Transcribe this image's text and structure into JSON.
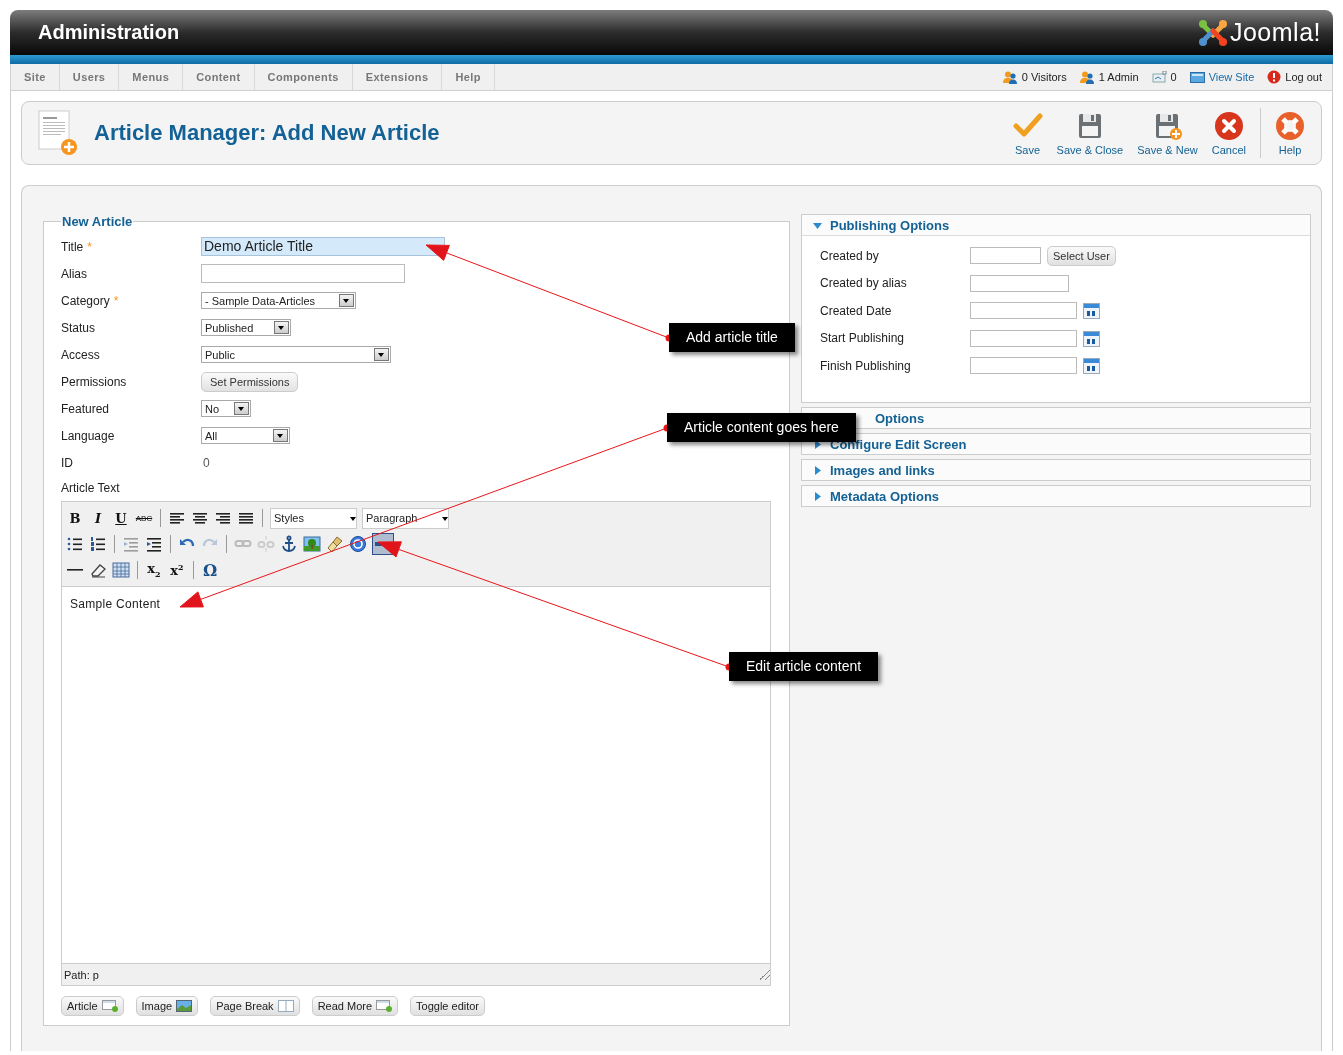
{
  "header": {
    "title": "Administration",
    "logo": "Joomla!"
  },
  "menu": [
    {
      "label": "Site"
    },
    {
      "label": "Users"
    },
    {
      "label": "Menus"
    },
    {
      "label": "Content"
    },
    {
      "label": "Components"
    },
    {
      "label": "Extensions"
    },
    {
      "label": "Help"
    }
  ],
  "status": [
    {
      "kind": "visitors",
      "label": "0 Visitors"
    },
    {
      "kind": "admins",
      "label": "1 Admin"
    },
    {
      "kind": "messages",
      "label": "0"
    },
    {
      "kind": "view-site",
      "label": "View Site"
    },
    {
      "kind": "logout",
      "label": "Log out"
    }
  ],
  "page_title": "Article Manager: Add New Article",
  "toolbar": [
    {
      "kind": "save",
      "label": "Save"
    },
    {
      "kind": "save-close",
      "label": "Save & Close"
    },
    {
      "kind": "save-new",
      "label": "Save & New"
    },
    {
      "kind": "cancel",
      "label": "Cancel"
    },
    {
      "kind": "help",
      "label": "Help"
    }
  ],
  "form": {
    "legend": "New Article",
    "required_mark": "*",
    "fields": [
      {
        "label": "Title",
        "required": true,
        "kind": "text",
        "value": "Demo Article Title",
        "focused": true
      },
      {
        "label": "Alias",
        "required": false,
        "kind": "text",
        "focused": false
      },
      {
        "label": "Category",
        "required": true,
        "kind": "select",
        "value": "- Sample Data-Articles"
      },
      {
        "label": "Status",
        "required": false,
        "kind": "select",
        "value": "Published"
      },
      {
        "label": "Access",
        "required": false,
        "kind": "select",
        "value": "Public"
      },
      {
        "label": "Permissions",
        "required": false,
        "kind": "button",
        "value": "Set Permissions"
      },
      {
        "label": "Featured",
        "required": false,
        "kind": "select",
        "value": "No"
      },
      {
        "label": "Language",
        "required": false,
        "kind": "select",
        "value": "All"
      },
      {
        "label": "ID",
        "required": false,
        "kind": "static",
        "value": "0"
      }
    ]
  },
  "editor": {
    "label": "Article Text",
    "content": "Sample Content",
    "path": "Path: p",
    "tools": [
      [
        {
          "kind": "bold",
          "text": "B"
        },
        {
          "kind": "italic",
          "text": "I"
        },
        {
          "kind": "underline",
          "text": "U"
        },
        {
          "kind": "strike",
          "text": "ABC"
        },
        {
          "kind": "separator"
        },
        {
          "kind": "align-left"
        },
        {
          "kind": "align-center"
        },
        {
          "kind": "align-right"
        },
        {
          "kind": "justify"
        },
        {
          "kind": "separator"
        },
        {
          "kind": "select",
          "text": "Styles"
        },
        {
          "kind": "select",
          "text": "Paragraph"
        }
      ],
      [
        {
          "kind": "bullet-list"
        },
        {
          "kind": "numbered-list"
        },
        {
          "kind": "separator"
        },
        {
          "kind": "outdent"
        },
        {
          "kind": "indent"
        },
        {
          "kind": "separator"
        },
        {
          "kind": "undo"
        },
        {
          "kind": "redo"
        },
        {
          "kind": "separator"
        },
        {
          "kind": "link"
        },
        {
          "kind": "unlink"
        },
        {
          "kind": "anchor"
        },
        {
          "kind": "image"
        },
        {
          "kind": "cleanup"
        },
        {
          "kind": "help"
        },
        {
          "kind": "html"
        }
      ],
      [
        {
          "kind": "rule"
        },
        {
          "kind": "eraser"
        },
        {
          "kind": "table"
        },
        {
          "kind": "separator"
        },
        {
          "kind": "subscript",
          "text": "x$_{2}$"
        },
        {
          "kind": "superscript",
          "text": "x$^{2}$"
        },
        {
          "kind": "separator"
        },
        {
          "kind": "charmap",
          "text": "Ω"
        }
      ]
    ],
    "buttons": [
      {
        "kind": "article",
        "label": "Article"
      },
      {
        "kind": "image",
        "label": "Image"
      },
      {
        "kind": "pagebreak",
        "label": "Page Break"
      },
      {
        "kind": "readmore",
        "label": "Read More"
      },
      {
        "kind": "toggle",
        "label": "Toggle editor"
      }
    ]
  },
  "panels": [
    {
      "title": "Publishing Options",
      "expanded": true,
      "fields": [
        {
          "label": "Created by",
          "kind": "user",
          "button": "Select User"
        },
        {
          "label": "Created by alias",
          "kind": "text"
        },
        {
          "label": "Created Date",
          "kind": "date"
        },
        {
          "label": "Start Publishing",
          "kind": "date"
        },
        {
          "label": "Finish Publishing",
          "kind": "date"
        }
      ]
    },
    {
      "title": "Options",
      "expanded": false
    },
    {
      "title": "Configure Edit Screen",
      "expanded": false
    },
    {
      "title": "Images and links",
      "expanded": false
    },
    {
      "title": "Metadata Options",
      "expanded": false
    }
  ],
  "callouts": [
    {
      "text": "Add article title"
    },
    {
      "text": "Article content goes here"
    },
    {
      "text": "Edit article content"
    }
  ]
}
